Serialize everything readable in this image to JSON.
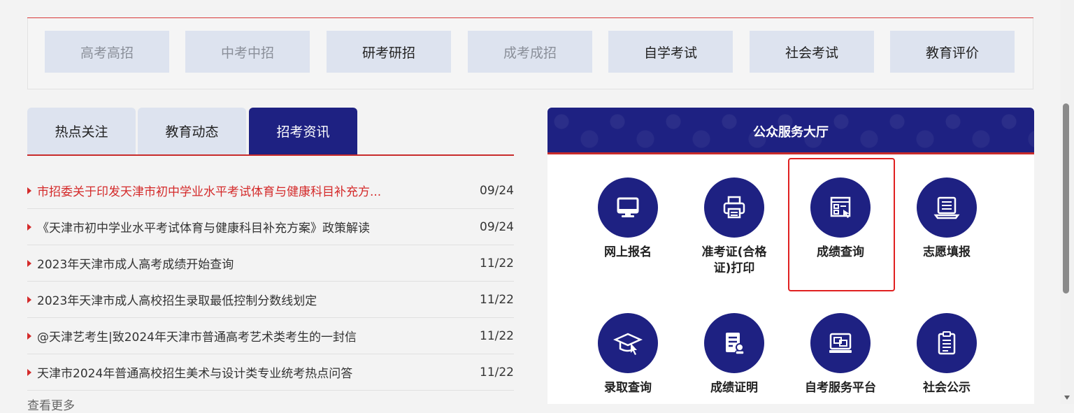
{
  "categories": [
    {
      "label": "高考高招",
      "style": "dim"
    },
    {
      "label": "中考中招",
      "style": "dim"
    },
    {
      "label": "研考研招",
      "style": "bold"
    },
    {
      "label": "成考成招",
      "style": "dim"
    },
    {
      "label": "自学考试",
      "style": "bold"
    },
    {
      "label": "社会考试",
      "style": "bold"
    },
    {
      "label": "教育评价",
      "style": "bold"
    }
  ],
  "tabs": [
    {
      "label": "热点关注"
    },
    {
      "label": "教育动态"
    },
    {
      "label": "招考资讯",
      "active": true
    }
  ],
  "news": [
    {
      "title": "市招委关于印发天津市初中学业水平考试体育与健康科目补充方...",
      "date": "09/24",
      "hot": true
    },
    {
      "title": "《天津市初中学业水平考试体育与健康科目补充方案》政策解读",
      "date": "09/24"
    },
    {
      "title": "2023年天津市成人高考成绩开始查询",
      "date": "11/22"
    },
    {
      "title": "2023年天津市成人高校招生录取最低控制分数线划定",
      "date": "11/22"
    },
    {
      "title": "@天津艺考生|致2024年天津市普通高考艺术类考生的一封信",
      "date": "11/22"
    },
    {
      "title": "天津市2024年普通高校招生美术与设计类专业统考热点问答",
      "date": "11/22"
    }
  ],
  "more_label": "查看更多",
  "service": {
    "title": "公众服务大厅",
    "items": [
      {
        "label": "网上报名",
        "icon": "monitor-icon"
      },
      {
        "label": "准考证(合格证)打印",
        "icon": "printer-icon"
      },
      {
        "label": "成绩查询",
        "icon": "score-query-icon"
      },
      {
        "label": "志愿填报",
        "icon": "laptop-list-icon"
      },
      {
        "label": "录取查询",
        "icon": "graduation-cap-icon"
      },
      {
        "label": "成绩证明",
        "icon": "certificate-icon"
      },
      {
        "label": "自考服务平台",
        "icon": "screen-platform-icon"
      },
      {
        "label": "社会公示",
        "icon": "clipboard-icon"
      }
    ]
  },
  "colors": {
    "accent": "#1e2182",
    "red": "#d42a2a",
    "tab_bg": "#dde3ef"
  }
}
